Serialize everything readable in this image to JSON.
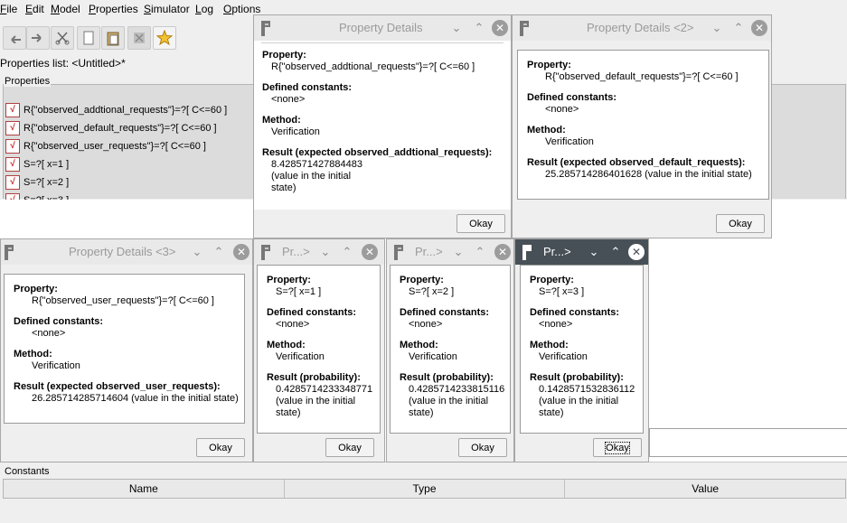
{
  "menu": [
    "File",
    "Edit",
    "Model",
    "Properties",
    "Simulator",
    "Log",
    "Options"
  ],
  "toolbar_icons": [
    "undo-icon",
    "redo-icon",
    "cut-icon",
    "copy-icon",
    "paste-icon",
    "delete-icon",
    "favorite-star-icon"
  ],
  "properties_list_title": "Properties list: <Untitled>*",
  "properties_legend": "Properties",
  "properties": [
    "R{\"observed_addtional_requests\"}=?[ C<=60 ]",
    "R{\"observed_default_requests\"}=?[ C<=60 ]",
    "R{\"observed_user_requests\"}=?[ C<=60 ]",
    "S=?[ x=1 ]",
    "S=?[ x=2 ]",
    "S=?[ x=3 ]"
  ],
  "constants": {
    "legend": "Constants",
    "columns": [
      "Name",
      "Type",
      "Value"
    ]
  },
  "labels": {
    "property": "Property:",
    "defined_constants": "Defined constants:",
    "method": "Method:"
  },
  "dialogs": [
    {
      "title": "Property Details",
      "property": "R{\"observed_addtional_requests\"}=?[ C<=60 ]",
      "constants": "<none>",
      "method": "Verification",
      "result_label": "Result (expected observed_addtional_requests):",
      "result_value": "8.428571427884483",
      "result_note": "(value in the initial state)",
      "ok": "Okay"
    },
    {
      "title": "Property Details <2>",
      "property": "R{\"observed_default_requests\"}=?[ C<=60 ]",
      "constants": "<none>",
      "method": "Verification",
      "result_label": "Result (expected observed_default_requests):",
      "result_value": "25.285714286401628 (value in the initial state)",
      "ok": "Okay"
    },
    {
      "title": "Property Details <3>",
      "property": "R{\"observed_user_requests\"}=?[ C<=60 ]",
      "constants": "<none>",
      "method": "Verification",
      "result_label": "Result (expected observed_user_requests):",
      "result_value": "26.285714285714604 (value in the initial state)",
      "ok": "Okay"
    },
    {
      "title": "Pr...>",
      "property": "S=?[ x=1 ]",
      "constants": "<none>",
      "method": "Verification",
      "result_label": "Result (probability):",
      "result_value": "0.4285714233348771",
      "result_note": "(value in the initial state)",
      "ok": "Okay"
    },
    {
      "title": "Pr...>",
      "property": "S=?[ x=2 ]",
      "constants": "<none>",
      "method": "Verification",
      "result_label": "Result (probability):",
      "result_value": "0.4285714233815116",
      "result_note": "(value in the initial state)",
      "ok": "Okay"
    },
    {
      "title": "Pr...>",
      "property": "S=?[ x=3 ]",
      "constants": "<none>",
      "method": "Verification",
      "result_label": "Result (probability):",
      "result_value": "0.1428571532836112",
      "result_note": "(value in the initial state)",
      "ok": "Okay"
    }
  ]
}
